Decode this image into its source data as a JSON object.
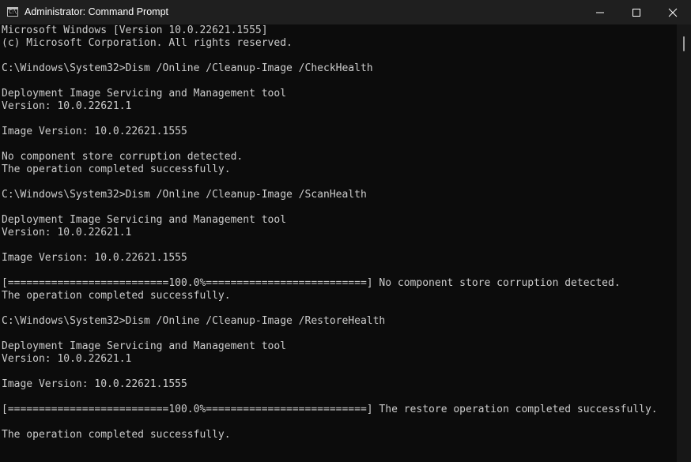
{
  "window": {
    "title": "Administrator: Command Prompt",
    "icon": "command-prompt-icon",
    "icon_text": "C:\\"
  },
  "controls": {
    "minimize": "minimize-icon",
    "maximize": "maximize-icon",
    "close": "close-icon"
  },
  "console": {
    "lines": [
      "Microsoft Windows [Version 10.0.22621.1555]",
      "(c) Microsoft Corporation. All rights reserved.",
      "",
      "C:\\Windows\\System32>Dism /Online /Cleanup-Image /CheckHealth",
      "",
      "Deployment Image Servicing and Management tool",
      "Version: 10.0.22621.1",
      "",
      "Image Version: 10.0.22621.1555",
      "",
      "No component store corruption detected.",
      "The operation completed successfully.",
      "",
      "C:\\Windows\\System32>Dism /Online /Cleanup-Image /ScanHealth",
      "",
      "Deployment Image Servicing and Management tool",
      "Version: 10.0.22621.1",
      "",
      "Image Version: 10.0.22621.1555",
      "",
      "[==========================100.0%==========================] No component store corruption detected.",
      "The operation completed successfully.",
      "",
      "C:\\Windows\\System32>Dism /Online /Cleanup-Image /RestoreHealth",
      "",
      "Deployment Image Servicing and Management tool",
      "Version: 10.0.22621.1",
      "",
      "Image Version: 10.0.22621.1555",
      "",
      "[==========================100.0%==========================] The restore operation completed successfully.",
      "",
      "The operation completed successfully."
    ]
  },
  "colors": {
    "titlebar": "#1f1f1f",
    "console_bg": "#0c0c0c",
    "console_text": "#cccccc"
  }
}
